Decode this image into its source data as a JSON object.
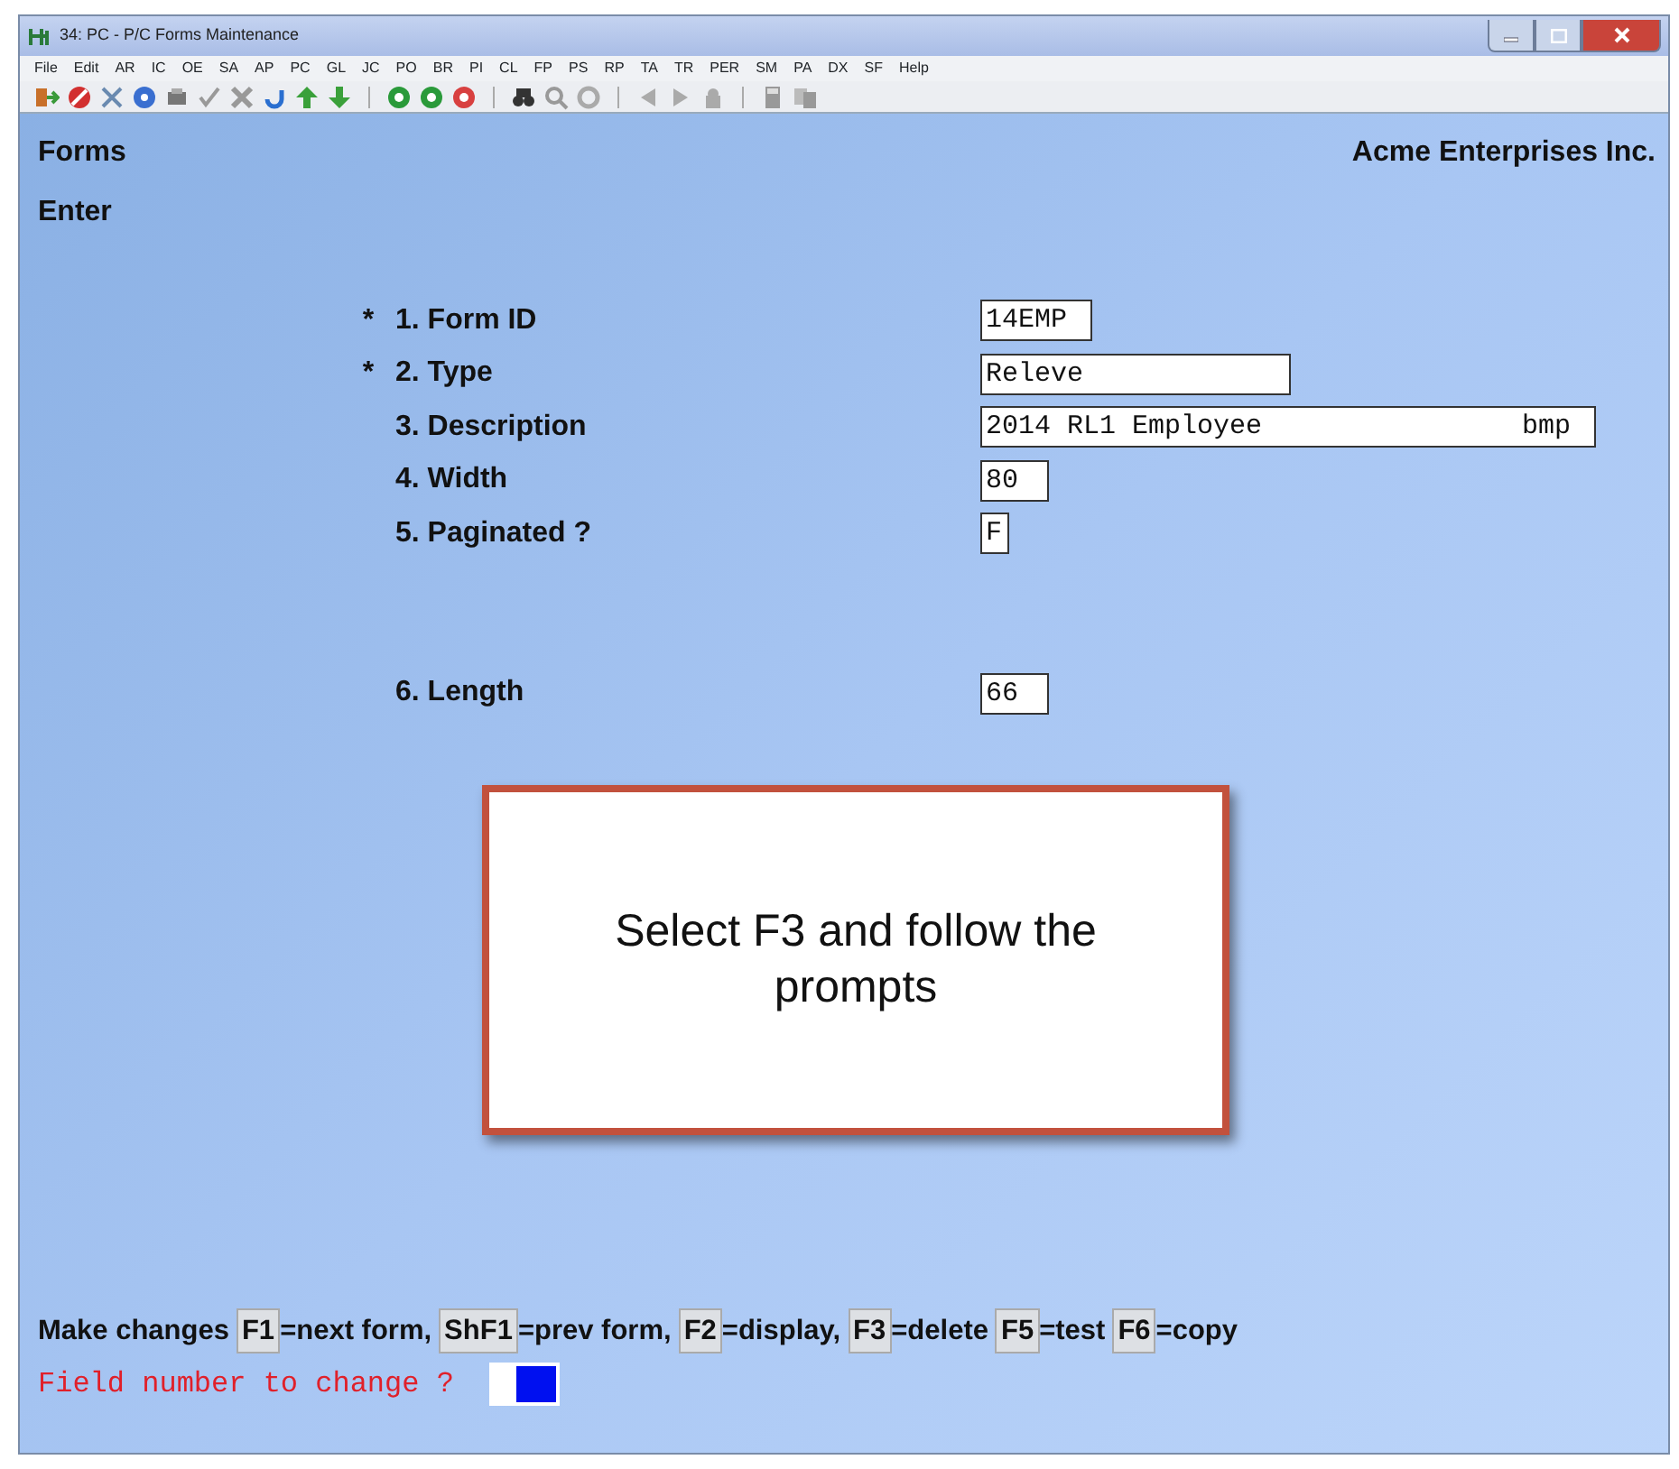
{
  "window": {
    "title": "34: PC - P/C Forms Maintenance"
  },
  "menu": [
    "File",
    "Edit",
    "AR",
    "IC",
    "OE",
    "SA",
    "AP",
    "PC",
    "GL",
    "JC",
    "PO",
    "BR",
    "PI",
    "CL",
    "FP",
    "PS",
    "RP",
    "TA",
    "TR",
    "PER",
    "SM",
    "PA",
    "DX",
    "SF",
    "Help"
  ],
  "header": {
    "screen": "Forms",
    "company": "Acme Enterprises Inc.",
    "mode": "Enter"
  },
  "fields": [
    {
      "marker": "*",
      "label": "1. Form ID",
      "value": "14EMP"
    },
    {
      "marker": "*",
      "label": "2. Type",
      "value": "Releve"
    },
    {
      "label": "3. Description",
      "value": "2014 RL1 Employee                bmp"
    },
    {
      "label": "4. Width",
      "value": "80"
    },
    {
      "label": "5. Paginated ?",
      "value": "F"
    },
    {
      "label": "6. Length",
      "value": "66"
    }
  ],
  "callout": {
    "text": "Select F3 and follow the prompts"
  },
  "footer": {
    "lead": "Make changes",
    "keys": [
      {
        "key": "F1",
        "text": "=next form,"
      },
      {
        "key": "ShF1",
        "text": "=prev form,"
      },
      {
        "key": "F2",
        "text": "=display,"
      },
      {
        "key": "F3",
        "text": "=delete"
      },
      {
        "key": "F5",
        "text": "=test"
      },
      {
        "key": "F6",
        "text": "=copy"
      }
    ]
  },
  "prompt": {
    "text": "Field number to change ?"
  }
}
